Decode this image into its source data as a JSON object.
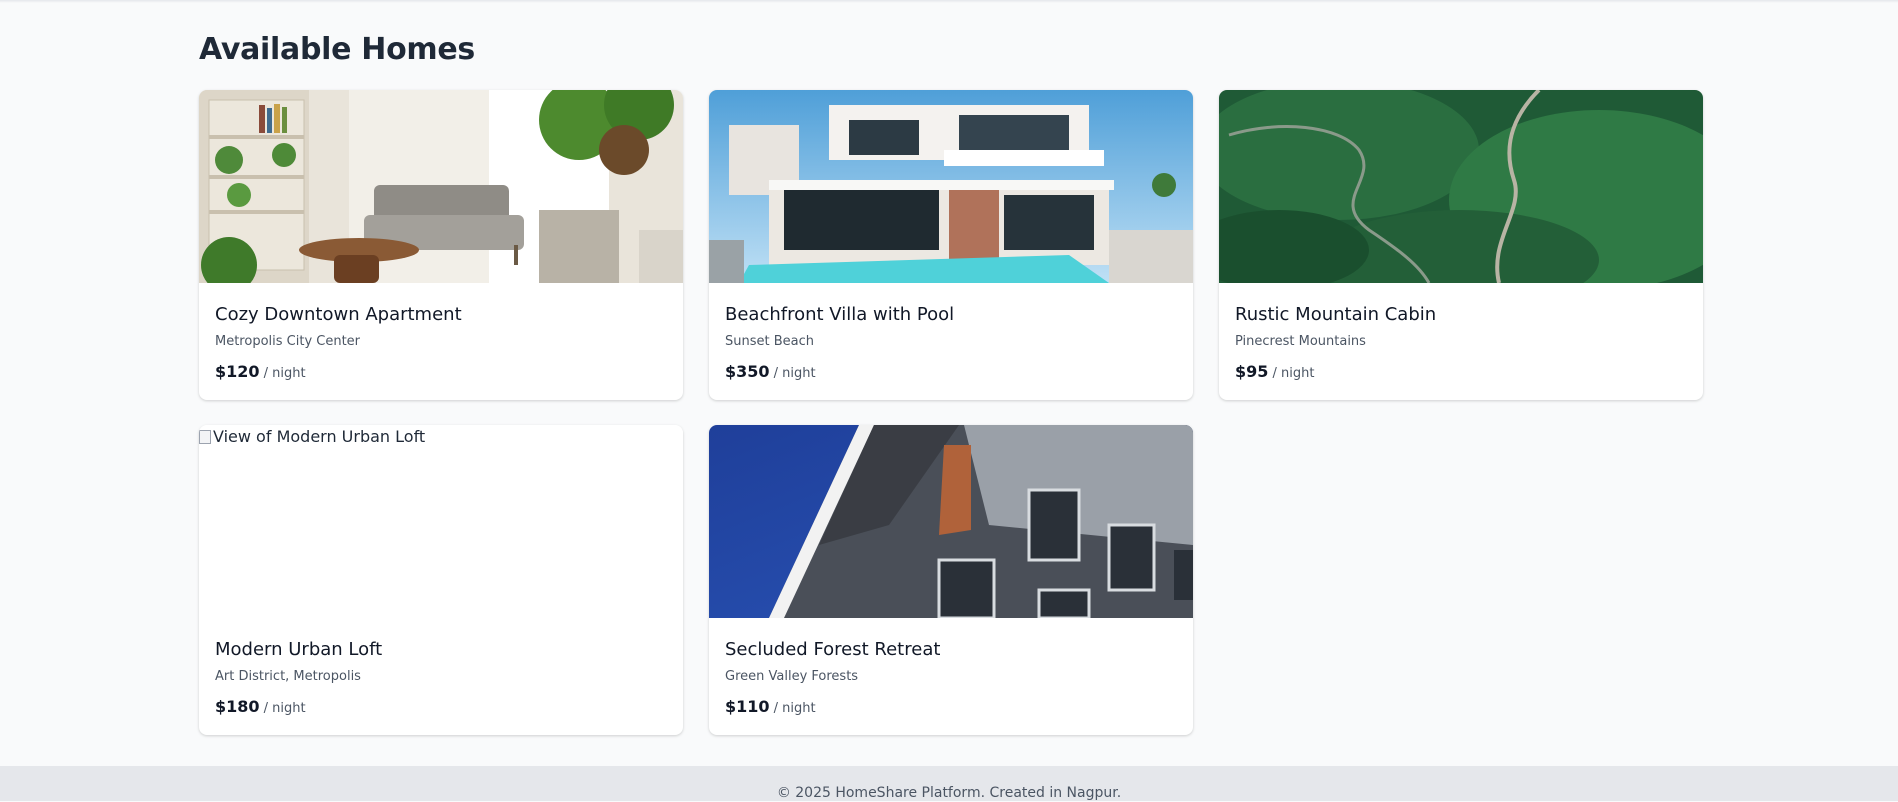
{
  "page": {
    "title": "Available Homes"
  },
  "listings": [
    {
      "title": "Cozy Downtown Apartment",
      "location": "Metropolis City Center",
      "price": "$120",
      "unit": "/ night",
      "image": "living-room-photo"
    },
    {
      "title": "Beachfront Villa with Pool",
      "location": "Sunset Beach",
      "price": "$350",
      "unit": "/ night",
      "image": "villa-pool-photo"
    },
    {
      "title": "Rustic Mountain Cabin",
      "location": "Pinecrest Mountains",
      "price": "$95",
      "unit": "/ night",
      "image": "mountain-road-photo"
    },
    {
      "title": "Modern Urban Loft",
      "location": "Art District, Metropolis",
      "price": "$180",
      "unit": "/ night",
      "image_alt": "View of Modern Urban Loft"
    },
    {
      "title": "Secluded Forest Retreat",
      "location": "Green Valley Forests",
      "price": "$110",
      "unit": "/ night",
      "image": "building-facade-photo"
    }
  ],
  "footer": {
    "text": "© 2025 HomeShare Platform. Created in Nagpur."
  },
  "colors": {
    "background": "#f9fafb",
    "card": "#ffffff",
    "footer": "#e5e7eb",
    "heading": "#1f2937"
  }
}
